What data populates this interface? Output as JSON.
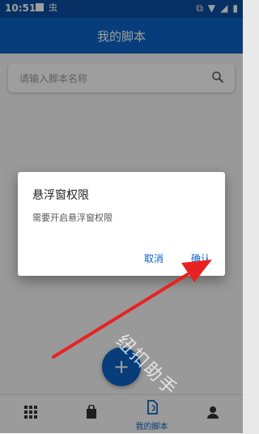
{
  "status_bar": {
    "time": "10:51",
    "left_icons": [
      "square-icon",
      "bug-icon"
    ],
    "right_icons": [
      "cast-icon",
      "wifi-icon",
      "signal-icon",
      "battery-icon"
    ]
  },
  "app_bar": {
    "title": "我的脚本",
    "color": "#0b63c6"
  },
  "search": {
    "placeholder": "请输入脚本名称",
    "icon": "search-icon"
  },
  "fab": {
    "label": "+"
  },
  "bottom_nav": {
    "items": [
      {
        "label": "",
        "icon": "grid-icon"
      },
      {
        "label": "",
        "icon": "bag-icon"
      },
      {
        "label": "我的脚本",
        "icon": "script-doc-icon",
        "selected": true
      },
      {
        "label": "",
        "icon": "profile-icon"
      }
    ]
  },
  "dialog": {
    "title": "悬浮窗权限",
    "message": "需要开启悬浮窗权限",
    "cancel_label": "取消",
    "confirm_label": "确认"
  },
  "watermark": {
    "text": "纽扣助手"
  }
}
